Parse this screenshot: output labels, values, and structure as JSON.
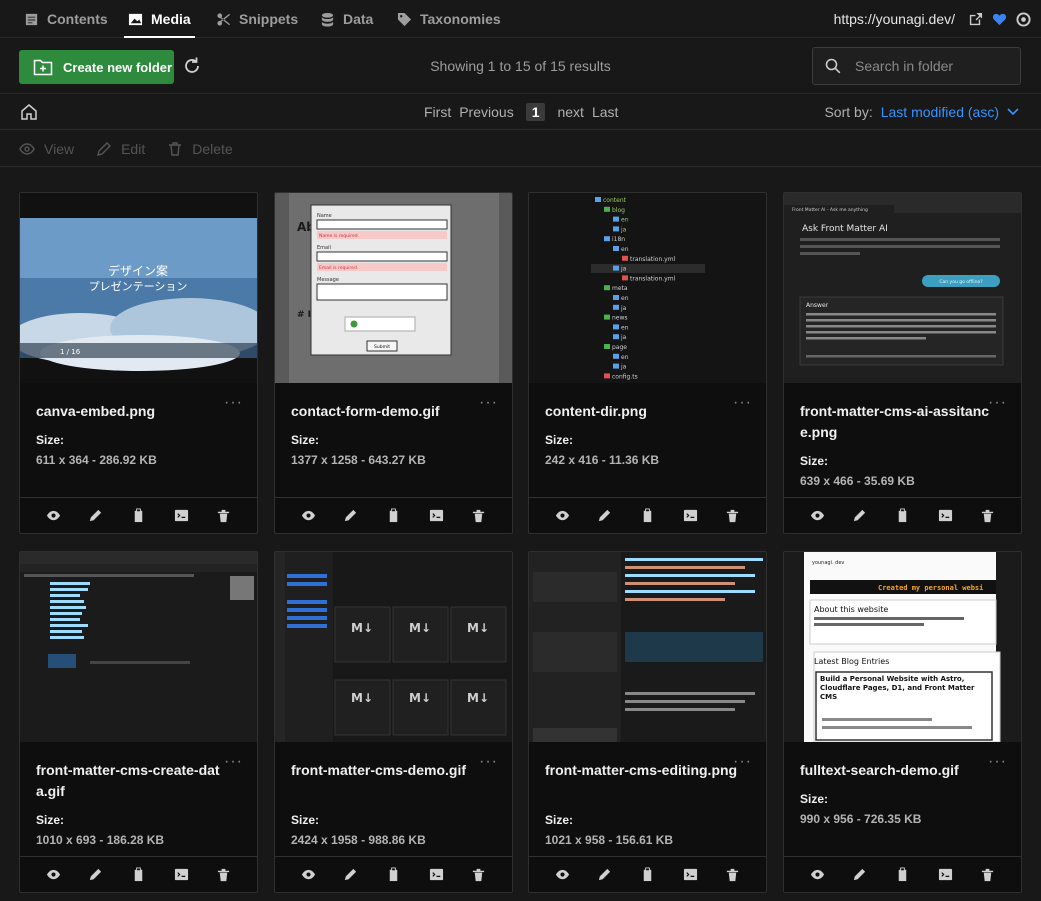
{
  "nav": {
    "tabs": [
      {
        "label": "Contents",
        "icon": "contents-icon"
      },
      {
        "label": "Media",
        "icon": "media-icon"
      },
      {
        "label": "Snippets",
        "icon": "snippets-icon"
      },
      {
        "label": "Data",
        "icon": "data-icon"
      },
      {
        "label": "Taxonomies",
        "icon": "taxonomies-icon"
      }
    ],
    "site_url": "https://younagi.dev/",
    "heart_color": "#3b82f6"
  },
  "toolbar": {
    "create_label": "Create new folder",
    "showing": "Showing 1 to 15 of 15 results",
    "search_placeholder": "Search in folder"
  },
  "pager": {
    "first": "First",
    "previous": "Previous",
    "page": "1",
    "next": "next",
    "last": "Last",
    "sort_label": "Sort by:",
    "sort_value": "Last modified (asc)"
  },
  "actions": {
    "view": "View",
    "edit": "Edit",
    "delete": "Delete"
  },
  "size_label": "Size:",
  "cards": [
    {
      "name": "canva-embed.png",
      "size": "611 x 364 - 286.92 KB"
    },
    {
      "name": "contact-form-demo.gif",
      "size": "1377 x 1258 - 643.27 KB"
    },
    {
      "name": "content-dir.png",
      "size": "242 x 416 - 11.36 KB"
    },
    {
      "name": "front-matter-cms-ai-assitance.png",
      "size": "639 x 466 - 35.69 KB"
    },
    {
      "name": "front-matter-cms-create-data.gif",
      "size": "1010 x 693 - 186.28 KB"
    },
    {
      "name": "front-matter-cms-demo.gif",
      "size": "2424 x 1958 - 988.86 KB"
    },
    {
      "name": "front-matter-cms-editing.png",
      "size": "1021 x 958 - 156.61 KB"
    },
    {
      "name": "fulltext-search-demo.gif",
      "size": "990 x 956 - 726.35 KB"
    }
  ],
  "thumbs": {
    "canva": {
      "line1": "デザイン案",
      "line2": "プレゼンテーション",
      "pageinfo": "1 / 16"
    },
    "contact": {
      "heading": "Abo",
      "name_lbl": "Name",
      "email_lbl": "Email",
      "msg_lbl": "Message",
      "err1": "Name is required.",
      "err2": "Email is required.",
      "submit": "Submit",
      "intro": "# Intro"
    },
    "tree": [
      "content",
      "blog",
      "en",
      "ja",
      "i18n",
      "en",
      "translation.yml",
      "ja",
      "translation.yml",
      "meta",
      "en",
      "ja",
      "news",
      "en",
      "ja",
      "page",
      "en",
      "ja",
      "config.ts"
    ],
    "ai": {
      "title": "Ask Front Matter AI",
      "question": "Can you go offline?",
      "answer": "Answer",
      "tab": "Front Matter AI - Ask me anything"
    },
    "search": {
      "site": "younagi. dev",
      "banner": "Created my personal websi",
      "about": "About this website",
      "latest": "Latest Blog Entries",
      "post": "Build a Personal Website with Astro, Cloudflare Pages, D1, and Front Matter CMS"
    }
  }
}
